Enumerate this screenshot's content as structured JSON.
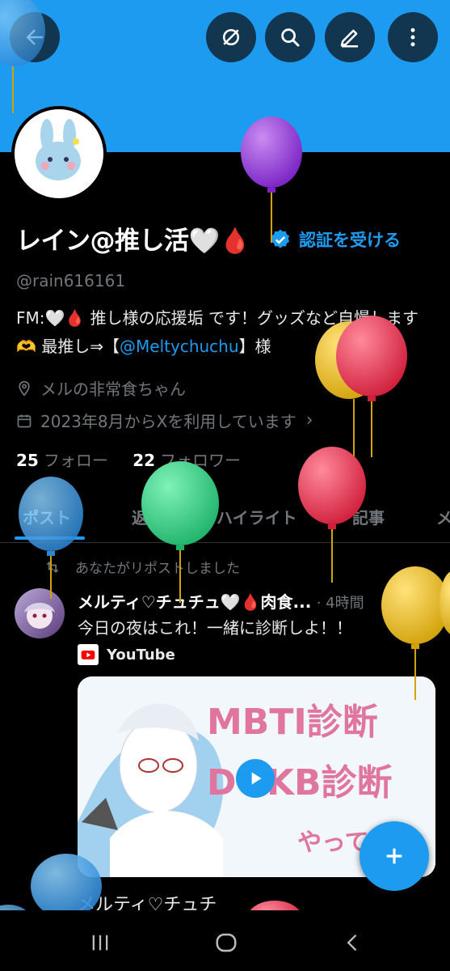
{
  "profile": {
    "name": "レイン@推し活🤍🩸",
    "verify_label": "認証を受ける",
    "handle": "@rain616161",
    "bio_pre": "FM:🤍🩸 推し様の応援垢 です！グッズなど自慢します🫶 最推し⇒【",
    "bio_link": "@Meltychuchu",
    "bio_post": "】様",
    "location": "メルの非常食ちゃん",
    "joined": "2023年8月からXを利用しています",
    "following_count": "25",
    "following_label": "フォロー",
    "followers_count": "22",
    "followers_label": "フォロワー"
  },
  "tabs": [
    "ポスト",
    "返信",
    "ハイライト",
    "記事",
    "メ"
  ],
  "active_tab": "ポスト",
  "post": {
    "context": "あなたがリポストしました",
    "author": "メルティ♡チュチュ🤍🩸肉食...",
    "time": "· 4時間",
    "text": "今日の夜はこれ！一緒に診断しよ！！",
    "source": "YouTube",
    "thumb_line1": "MBTI診断",
    "thumb_line2": "DOKB診断",
    "thumb_line3": "やってみ"
  },
  "next_post_author": "メルティ♡チュチ",
  "icons": [
    "back-arrow-icon",
    "hide-icon",
    "search-icon",
    "edit-icon",
    "more-icon",
    "verified-badge-icon",
    "location-icon",
    "calendar-icon",
    "repost-icon",
    "youtube-icon",
    "plus-icon",
    "play-icon"
  ],
  "colors": {
    "accent": "#1d9bf0",
    "background": "#000000",
    "muted": "#71767b"
  }
}
